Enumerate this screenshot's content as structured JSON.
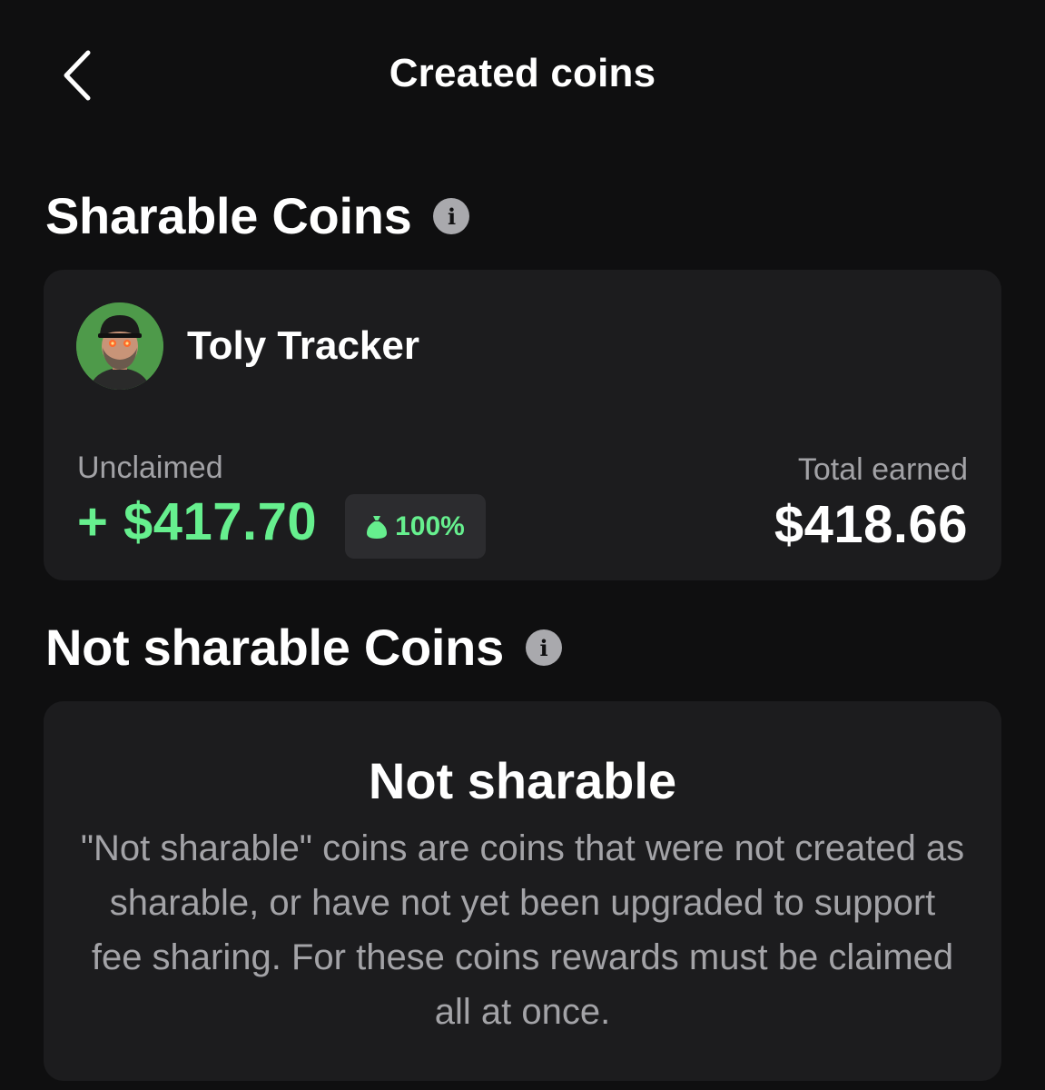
{
  "header": {
    "title": "Created coins",
    "back_icon": "chevron-left-icon"
  },
  "sharable": {
    "heading": "Sharable Coins",
    "info_icon": "info-icon",
    "coins": [
      {
        "name": "Toly Tracker",
        "unclaimed_label": "Unclaimed",
        "unclaimed_value": "+ $417.70",
        "badge_icon": "money-bag-icon",
        "badge_percent": "100%",
        "total_label": "Total earned",
        "total_value": "$418.66"
      }
    ]
  },
  "not_sharable": {
    "heading": "Not sharable Coins",
    "info_icon": "info-icon",
    "empty_title": "Not sharable",
    "empty_text": "\"Not sharable\" coins are coins that were not created as sharable, or have not yet been upgraded to support fee sharing. For these coins rewards must be claimed all at once."
  },
  "colors": {
    "background": "#0f0f10",
    "card": "#1c1c1e",
    "accent_green": "#66ef8e",
    "muted_text": "#a2a2a6",
    "avatar_bg": "#4e9a4a"
  }
}
